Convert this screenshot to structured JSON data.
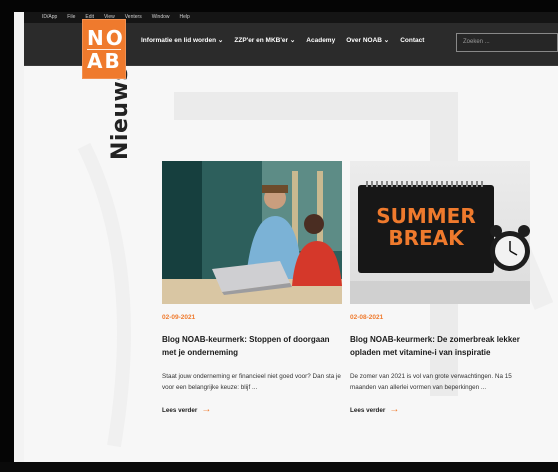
{
  "mac_menu": [
    "",
    "ID/App",
    "File",
    "Edit",
    "View",
    "Venters",
    "Window",
    "Help"
  ],
  "logo": {
    "line1": "NO",
    "line2": "AB"
  },
  "nav": {
    "items": [
      "Informatie en lid worden ⌄",
      "ZZP'er en MKB'er ⌄",
      "Academy",
      "Over NOAB ⌄",
      "Contact"
    ],
    "search_placeholder": "Zoeken ..."
  },
  "page": {
    "heading": "Nieuws"
  },
  "articles": [
    {
      "date": "02-09-2021",
      "title": "Blog NOAB-keurmerk: Stoppen of doorgaan met je onderneming",
      "excerpt": "Staat jouw onderneming er financieel niet goed voor? Dan sta je voor een belangrijke keuze: blijf ...",
      "more": "Lees verder",
      "image_icon": "office-laptop-photo"
    },
    {
      "date": "02-08-2021",
      "title": "Blog NOAB-keurmerk: De zomerbreak lekker opladen met vitamine-i van inspiratie",
      "excerpt": "De zomer van 2021 is vol van grote verwachtingen. Na 15 maanden van allerlei vormen van beperkingen ...",
      "more": "Lees verder",
      "image_icon": "summer-break-photo",
      "image_text": [
        "SUMMER",
        "BREAK"
      ]
    }
  ],
  "colors": {
    "accent": "#ef7a2d",
    "nav_bg": "#2b2b2b"
  }
}
